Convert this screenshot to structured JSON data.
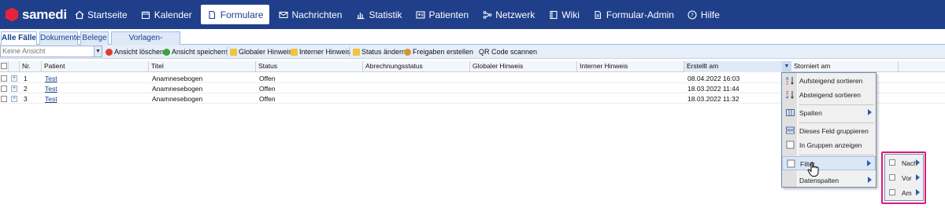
{
  "brand": "samedi",
  "nav": [
    {
      "label": "Startseite",
      "icon": "home-icon"
    },
    {
      "label": "Kalender",
      "icon": "calendar-icon"
    },
    {
      "label": "Formulare",
      "icon": "document-icon",
      "active": true
    },
    {
      "label": "Nachrichten",
      "icon": "mail-icon"
    },
    {
      "label": "Statistik",
      "icon": "chart-icon"
    },
    {
      "label": "Patienten",
      "icon": "contact-card-icon"
    },
    {
      "label": "Netzwerk",
      "icon": "network-icon"
    },
    {
      "label": "Wiki",
      "icon": "book-icon"
    },
    {
      "label": "Formular-Admin",
      "icon": "form-admin-icon"
    },
    {
      "label": "Hilfe",
      "icon": "help-icon"
    }
  ],
  "subtabs": [
    "Alle Fälle",
    "Dokumente",
    "Belege",
    "Vorlagen-Verwaltung"
  ],
  "toolbar": {
    "view_placeholder": "Keine Ansicht",
    "delete_view": "Ansicht löschen",
    "save_view": "Ansicht speichern",
    "global_note": "Globaler Hinweis",
    "internal_note": "Interner Hinweis",
    "change_status": "Status ändern",
    "create_release": "Freigaben erstellen",
    "scan_qr": "QR Code scannen"
  },
  "columns": [
    "Nr.",
    "Patient",
    "Titel",
    "Status",
    "Abrechnungsstatus",
    "Globaler Hinweis",
    "Interner Hinweis",
    "Erstellt am",
    "Storniert am"
  ],
  "rows": [
    {
      "nr": "1",
      "patient": "Test",
      "titel": "Anamnesebogen",
      "status": "Offen",
      "erstellt": "08.04.2022 16:03"
    },
    {
      "nr": "2",
      "patient": "Test",
      "titel": "Anamnesebogen",
      "status": "Offen",
      "erstellt": "18.03.2022 11:44"
    },
    {
      "nr": "3",
      "patient": "Test",
      "titel": "Anamnesebogen",
      "status": "Offen",
      "erstellt": "18.03.2022 11:32"
    }
  ],
  "menu": {
    "sort_asc": "Aufsteigend sortieren",
    "sort_desc": "Absteigend sortieren",
    "columns": "Spalten",
    "group_by": "Dieses Feld gruppieren",
    "show_in_groups": "In Gruppen anzeigen",
    "filter": "Filter",
    "data_columns": "Datenspalten"
  },
  "submenu": [
    "Nach",
    "Vor",
    "Am"
  ],
  "colors": {
    "nav_bg": "#1f3f8b",
    "highlight": "#d81b7a",
    "accent": "#15428b"
  }
}
